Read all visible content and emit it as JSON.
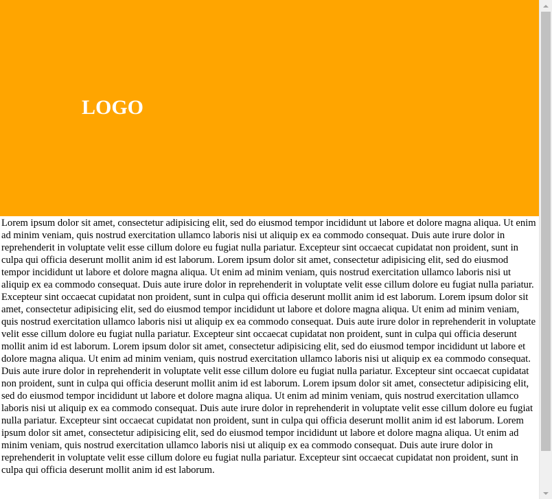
{
  "header": {
    "logo_text": "LOGO",
    "background_color": "#ffa500",
    "logo_color": "#ffffff"
  },
  "main": {
    "body_text": "Lorem ipsum dolor sit amet, consectetur adipisicing elit, sed do eiusmod tempor incididunt ut labore et dolore magna aliqua. Ut enim ad minim veniam, quis nostrud exercitation ullamco laboris nisi ut aliquip ex ea commodo consequat. Duis aute irure dolor in reprehenderit in voluptate velit esse cillum dolore eu fugiat nulla pariatur. Excepteur sint occaecat cupidatat non proident, sunt in culpa qui officia deserunt mollit anim id est laborum. Lorem ipsum dolor sit amet, consectetur adipisicing elit, sed do eiusmod tempor incididunt ut labore et dolore magna aliqua. Ut enim ad minim veniam, quis nostrud exercitation ullamco laboris nisi ut aliquip ex ea commodo consequat. Duis aute irure dolor in reprehenderit in voluptate velit esse cillum dolore eu fugiat nulla pariatur. Excepteur sint occaecat cupidatat non proident, sunt in culpa qui officia deserunt mollit anim id est laborum. Lorem ipsum dolor sit amet, consectetur adipisicing elit, sed do eiusmod tempor incididunt ut labore et dolore magna aliqua. Ut enim ad minim veniam, quis nostrud exercitation ullamco laboris nisi ut aliquip ex ea commodo consequat. Duis aute irure dolor in reprehenderit in voluptate velit esse cillum dolore eu fugiat nulla pariatur. Excepteur sint occaecat cupidatat non proident, sunt in culpa qui officia deserunt mollit anim id est laborum. Lorem ipsum dolor sit amet, consectetur adipisicing elit, sed do eiusmod tempor incididunt ut labore et dolore magna aliqua. Ut enim ad minim veniam, quis nostrud exercitation ullamco laboris nisi ut aliquip ex ea commodo consequat. Duis aute irure dolor in reprehenderit in voluptate velit esse cillum dolore eu fugiat nulla pariatur. Excepteur sint occaecat cupidatat non proident, sunt in culpa qui officia deserunt mollit anim id est laborum. Lorem ipsum dolor sit amet, consectetur adipisicing elit, sed do eiusmod tempor incididunt ut labore et dolore magna aliqua. Ut enim ad minim veniam, quis nostrud exercitation ullamco laboris nisi ut aliquip ex ea commodo consequat. Duis aute irure dolor in reprehenderit in voluptate velit esse cillum dolore eu fugiat nulla pariatur. Excepteur sint occaecat cupidatat non proident, sunt in culpa qui officia deserunt mollit anim id est laborum. Lorem ipsum dolor sit amet, consectetur adipisicing elit, sed do eiusmod tempor incididunt ut labore et dolore magna aliqua. Ut enim ad minim veniam, quis nostrud exercitation ullamco laboris nisi ut aliquip ex ea commodo consequat. Duis aute irure dolor in reprehenderit in voluptate velit esse cillum dolore eu fugiat nulla pariatur. Excepteur sint occaecat cupidatat non proident, sunt in culpa qui officia deserunt mollit anim id est laborum."
  },
  "scrollbar": {
    "up_icon": "scroll-up-arrow",
    "down_icon": "scroll-down-arrow"
  }
}
